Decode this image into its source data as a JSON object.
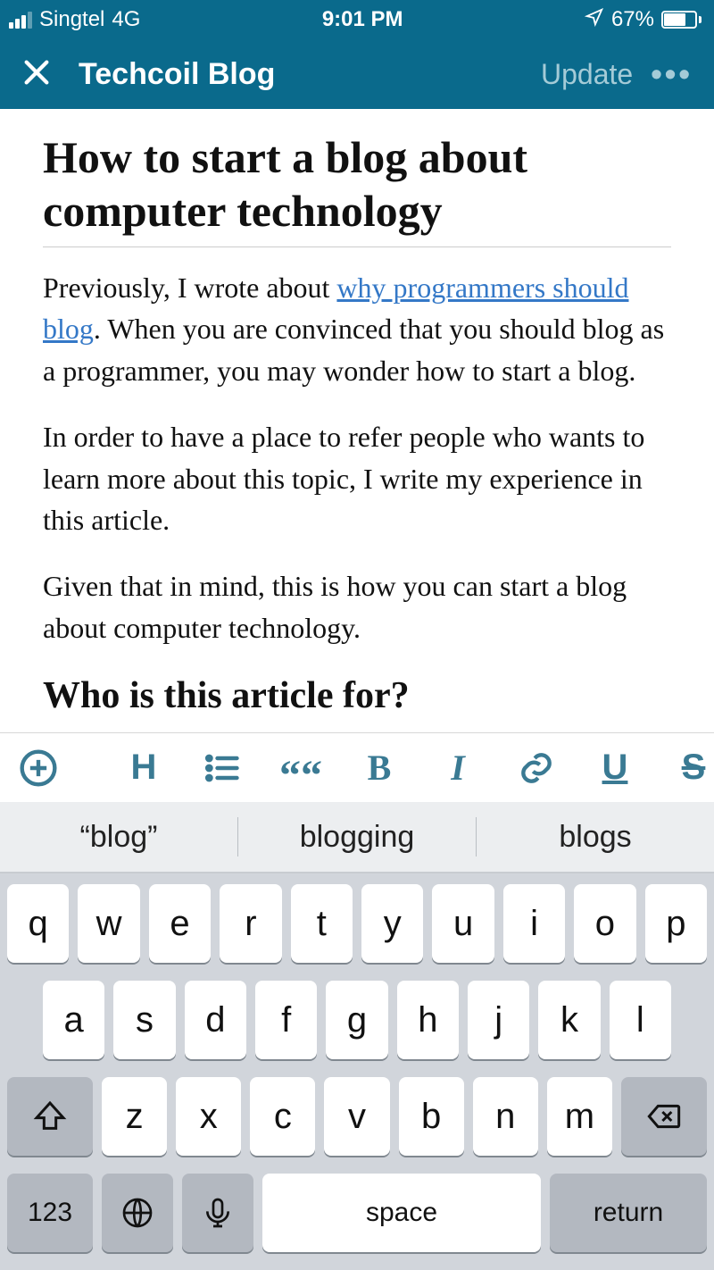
{
  "status": {
    "carrier": "Singtel",
    "network": "4G",
    "time": "9:01 PM",
    "battery_pct": "67%"
  },
  "nav": {
    "title": "Techcoil Blog",
    "update": "Update"
  },
  "post": {
    "title": "How to start a blog about computer technology",
    "p1a": "Previously, I wrote about ",
    "link1": "why programmers should blog",
    "p1b": ". When you are convinced that you should blog as a programmer, you may wonder how to start a blog.",
    "p2": "In order to have a place to refer people who wants to learn more about this topic, I write my experience in this article.",
    "p3": "Given that in mind, this is how you can start a blog about computer technology.",
    "h2": "Who is this article for?"
  },
  "toolbar": {
    "heading": "H",
    "quote": "““",
    "bold": "B",
    "italic": "I",
    "underline": "U",
    "strike": "S"
  },
  "keyboard": {
    "suggestions": [
      "“blog”",
      "blogging",
      "blogs"
    ],
    "row1": [
      "q",
      "w",
      "e",
      "r",
      "t",
      "y",
      "u",
      "i",
      "o",
      "p"
    ],
    "row2": [
      "a",
      "s",
      "d",
      "f",
      "g",
      "h",
      "j",
      "k",
      "l"
    ],
    "row3": [
      "z",
      "x",
      "c",
      "v",
      "b",
      "n",
      "m"
    ],
    "numkey": "123",
    "space": "space",
    "return": "return"
  }
}
